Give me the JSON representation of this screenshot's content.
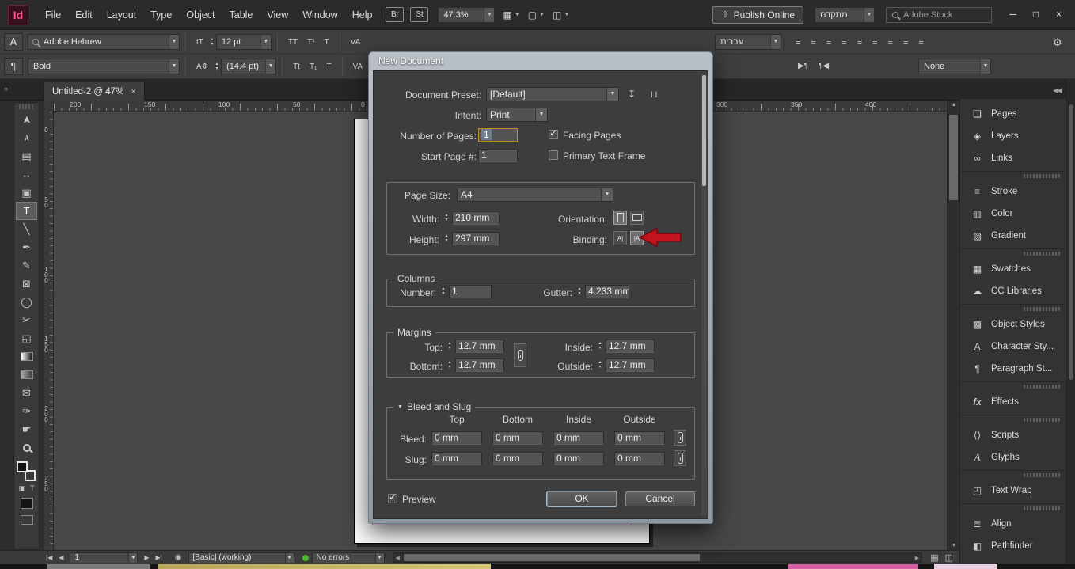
{
  "colors": {
    "focus_orange": "#c8882e",
    "annotation_red": "#c2131f",
    "status_green": "#4db82e",
    "text_selection_blue": "#6e7b8c",
    "margin_guide_violet": "#c678c6"
  },
  "icons": {
    "caret": "▼",
    "stepper": "▴\n▾",
    "check": "✓",
    "minimize": "─",
    "maximize": "□",
    "close": "×",
    "publish_upload": "⇧",
    "gear": "⚙",
    "save_preset": "↧",
    "delete_preset": "⊔",
    "collapse_panels": "◀◀",
    "expand_panel": "»",
    "first_page": "|◀",
    "prev_page": "◀",
    "next_page": "▶",
    "last_page": "▶|",
    "preflight": "◉",
    "align_lines": "≡",
    "dir_ltr": "▶¶",
    "dir_rtl": "¶◀",
    "kerning": "VA",
    "font_size_tool": "tT",
    "leading_tool": "A⇕",
    "scroll_up": "▲",
    "scroll_down": "▼",
    "scroll_left": "◀",
    "scroll_right": "▶",
    "view_grid": "▦",
    "view_square": "▢",
    "arrange_docs": "◫",
    "binding_ltr": "A|",
    "binding_rtl": "|A",
    "char_panel": "A",
    "para_panel": "¶",
    "apply_container": "▣",
    "apply_text": "T"
  },
  "menubar": {
    "logo": "Id",
    "menus": [
      "File",
      "Edit",
      "Layout",
      "Type",
      "Object",
      "Table",
      "View",
      "Window",
      "Help"
    ],
    "bridge_button": "Br",
    "stock_button": "St",
    "zoom_level": "47.3%",
    "publish_button": "Publish Online",
    "workspace": "מתקדם",
    "stock_search": "Adobe Stock"
  },
  "control_panel": {
    "font_family": "Adobe Hebrew",
    "font_style": "Bold",
    "font_size": "12 pt",
    "leading": "(14.4 pt)",
    "language": "עברית",
    "object_style": "None",
    "case_icons_row1": [
      "TT",
      "T¹",
      "T"
    ],
    "case_icons_row2": [
      "Tt",
      "T₁",
      "T"
    ]
  },
  "doc_tab": {
    "title": "Untitled-2 @ 47%",
    "close_icon": "×"
  },
  "ruler_h": {
    "labels_left": [
      "200",
      "150",
      "100",
      "50",
      "0"
    ],
    "labels_right": [
      "300",
      "350",
      "400"
    ]
  },
  "ruler_v": {
    "labels": [
      "0",
      "50",
      "100",
      "150",
      "200",
      "250"
    ]
  },
  "tools": [
    {
      "name": "selection",
      "glyph": "➤"
    },
    {
      "name": "direct-selection",
      "glyph": "➢"
    },
    {
      "name": "page",
      "glyph": "▤"
    },
    {
      "name": "gap",
      "glyph": "↔"
    },
    {
      "name": "content-collector",
      "glyph": "▣"
    },
    {
      "name": "type",
      "glyph": "T"
    },
    {
      "name": "line",
      "glyph": "╲"
    },
    {
      "name": "pen",
      "glyph": "✒"
    },
    {
      "name": "pencil",
      "glyph": "✎"
    },
    {
      "name": "rectangle-frame",
      "glyph": "⊠"
    },
    {
      "name": "ellipse",
      "glyph": "◯"
    },
    {
      "name": "scissors",
      "glyph": "✂"
    },
    {
      "name": "free-transform",
      "glyph": "◱"
    },
    {
      "name": "gradient-swatch",
      "glyph": ""
    },
    {
      "name": "gradient-feather",
      "glyph": ""
    },
    {
      "name": "note",
      "glyph": "✉"
    },
    {
      "name": "eyedropper",
      "glyph": "✑"
    },
    {
      "name": "hand",
      "glyph": "☛"
    },
    {
      "name": "zoom",
      "glyph": ""
    }
  ],
  "panels": [
    {
      "label": "Pages",
      "glyph": "❏"
    },
    {
      "label": "Layers",
      "glyph": "◈"
    },
    {
      "label": "Links",
      "glyph": "∞"
    },
    {
      "label": "Stroke",
      "glyph": "≡"
    },
    {
      "label": "Color",
      "glyph": "▥"
    },
    {
      "label": "Gradient",
      "glyph": "▧"
    },
    {
      "label": "Swatches",
      "glyph": "▦"
    },
    {
      "label": "CC Libraries",
      "glyph": "☁"
    },
    {
      "label": "Object Styles",
      "glyph": "▩"
    },
    {
      "label": "Character Sty...",
      "glyph": "A"
    },
    {
      "label": "Paragraph St...",
      "glyph": "¶"
    },
    {
      "label": "Effects",
      "glyph": "fx"
    },
    {
      "label": "Scripts",
      "glyph": "⟨⟩"
    },
    {
      "label": "Glyphs",
      "glyph": "A"
    },
    {
      "label": "Text Wrap",
      "glyph": "◰"
    },
    {
      "label": "Align",
      "glyph": "≣"
    },
    {
      "label": "Pathfinder",
      "glyph": "◧"
    }
  ],
  "dialog": {
    "title": "New Document",
    "preset_label": "Document Preset:",
    "preset_value": "[Default]",
    "intent_label": "Intent:",
    "intent_value": "Print",
    "num_pages_label": "Number of Pages:",
    "num_pages_value": "1",
    "facing_pages_label": "Facing Pages",
    "start_page_label": "Start Page #:",
    "start_page_value": "1",
    "primary_text_frame_label": "Primary Text Frame",
    "page_size": {
      "label": "Page Size:",
      "value": "A4",
      "width_label": "Width:",
      "width_value": "210 mm",
      "height_label": "Height:",
      "height_value": "297 mm",
      "orientation_label": "Orientation:",
      "binding_label": "Binding:"
    },
    "columns": {
      "legend": "Columns",
      "number_label": "Number:",
      "number_value": "1",
      "gutter_label": "Gutter:",
      "gutter_value": "4.233 mm"
    },
    "margins": {
      "legend": "Margins",
      "top_label": "Top:",
      "top_value": "12.7 mm",
      "bottom_label": "Bottom:",
      "bottom_value": "12.7 mm",
      "inside_label": "Inside:",
      "inside_value": "12.7 mm",
      "outside_label": "Outside:",
      "outside_value": "12.7 mm"
    },
    "bleed_slug": {
      "legend": "Bleed and Slug",
      "headers": [
        "Top",
        "Bottom",
        "Inside",
        "Outside"
      ],
      "bleed_label": "Bleed:",
      "bleed_values": [
        "0 mm",
        "0 mm",
        "0 mm",
        "0 mm"
      ],
      "slug_label": "Slug:",
      "slug_values": [
        "0 mm",
        "0 mm",
        "0 mm",
        "0 mm"
      ]
    },
    "preview_label": "Preview",
    "ok_label": "OK",
    "cancel_label": "Cancel"
  },
  "statusbar": {
    "page_value": "1",
    "preflight_profile": "[Basic] (working)",
    "status_text": "No errors"
  }
}
